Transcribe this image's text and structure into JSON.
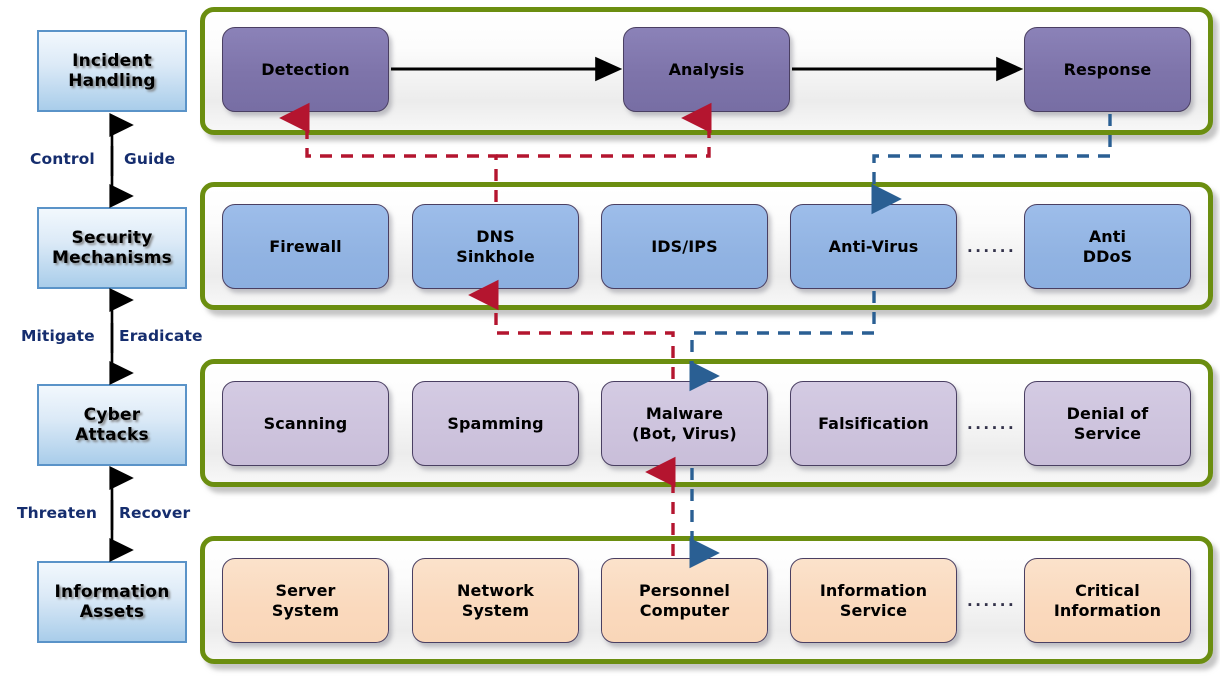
{
  "colors": {
    "panel_border": "#6b8e10",
    "left_box_border": "#5a93c8",
    "label_text": "#152d6e",
    "red_flow": "#b4152f",
    "blue_flow": "#2a5f93",
    "node_purple": "#7e74aa",
    "node_blue": "#91b3e2",
    "node_lilac": "#cdc3dd",
    "node_peach": "#fad9bd"
  },
  "left_column": {
    "layers": [
      {
        "id": "incident-handling",
        "label": "Incident\nHandling"
      },
      {
        "id": "security-mechanisms",
        "label": "Security\nMechanisms"
      },
      {
        "id": "cyber-attacks",
        "label": "Cyber\nAttacks"
      },
      {
        "id": "information-assets",
        "label": "Information\nAssets"
      }
    ],
    "connectors": [
      {
        "id": "control-guide",
        "down_label": "Control",
        "up_label": "Guide",
        "arrow": "bidirectional"
      },
      {
        "id": "mitigate-eradicate",
        "down_label": "Mitigate",
        "up_label": "Eradicate",
        "arrow": "down"
      },
      {
        "id": "threaten-recover",
        "down_label": "Threaten",
        "up_label": "Recover",
        "arrow": "bidirectional"
      }
    ]
  },
  "panels": [
    {
      "id": "incident-handling-panel",
      "kind": "purple",
      "ellipsis": null,
      "nodes": [
        {
          "id": "detection",
          "label": "Detection"
        },
        {
          "id": "analysis",
          "label": "Analysis"
        },
        {
          "id": "response",
          "label": "Response"
        }
      ]
    },
    {
      "id": "security-mechanisms-panel",
      "kind": "blue",
      "ellipsis": "......",
      "nodes": [
        {
          "id": "firewall",
          "label": "Firewall"
        },
        {
          "id": "dns-sinkhole",
          "label": "DNS\nSinkhole"
        },
        {
          "id": "ids-ips",
          "label": "IDS/IPS"
        },
        {
          "id": "anti-virus",
          "label": "Anti-Virus"
        },
        {
          "id": "anti-ddos",
          "label": "Anti\nDDoS"
        }
      ]
    },
    {
      "id": "cyber-attacks-panel",
      "kind": "lilac",
      "ellipsis": "......",
      "nodes": [
        {
          "id": "scanning",
          "label": "Scanning"
        },
        {
          "id": "spamming",
          "label": "Spamming"
        },
        {
          "id": "malware",
          "label": "Malware\n(Bot, Virus)"
        },
        {
          "id": "falsification",
          "label": "Falsification"
        },
        {
          "id": "denial-of-service",
          "label": "Denial of\nService"
        }
      ]
    },
    {
      "id": "information-assets-panel",
      "kind": "peach",
      "ellipsis": "......",
      "nodes": [
        {
          "id": "server-system",
          "label": "Server\nSystem"
        },
        {
          "id": "network-system",
          "label": "Network\nSystem"
        },
        {
          "id": "personnel-computer",
          "label": "Personnel\nComputer"
        },
        {
          "id": "information-service",
          "label": "Information\nService"
        },
        {
          "id": "critical-information",
          "label": "Critical\nInformation"
        }
      ]
    }
  ],
  "flows": {
    "process_arrows": [
      {
        "id": "detection-to-analysis",
        "from": "detection",
        "to": "analysis",
        "style": "solid-black"
      },
      {
        "id": "analysis-to-response",
        "from": "analysis",
        "to": "response",
        "style": "solid-black"
      }
    ],
    "detect_chain": {
      "id": "red-detect-chain",
      "style": "dashed-red",
      "path": [
        "personnel-computer",
        "malware",
        "dns-sinkhole",
        "detection",
        "analysis"
      ]
    },
    "respond_chain": {
      "id": "blue-respond-chain",
      "style": "dashed-blue",
      "path": [
        "response",
        "anti-virus",
        "malware",
        "personnel-computer"
      ]
    }
  }
}
